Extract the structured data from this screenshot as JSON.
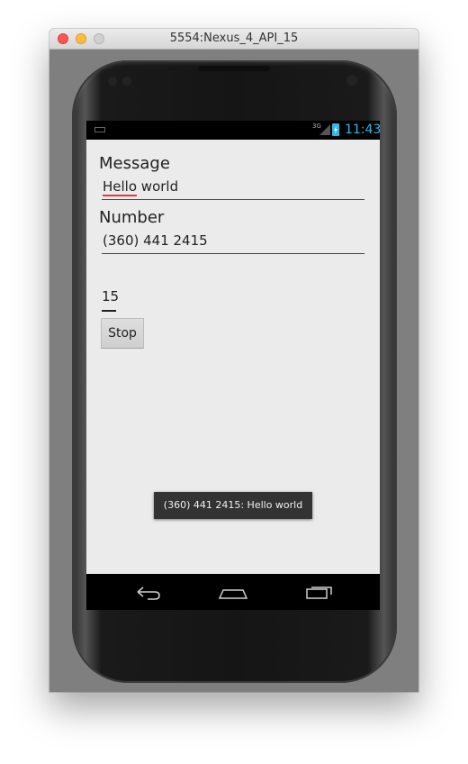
{
  "window": {
    "title": "5554:Nexus_4_API_15"
  },
  "status_bar": {
    "network": "3G",
    "time": "11:43"
  },
  "app": {
    "message_label": "Message",
    "message_value_word1": "Hello",
    "message_value_rest": " world",
    "number_label": "Number",
    "number_value": "(360) 441 2415",
    "counter_value": "15",
    "stop_button": "Stop"
  },
  "toast": {
    "text": "(360) 441 2415: Hello world"
  },
  "icons": {
    "keyboard": "keyboard-icon",
    "signal": "signal-icon",
    "battery": "battery-charging-icon",
    "back": "back-icon",
    "home": "home-icon",
    "recents": "recent-apps-icon"
  },
  "colors": {
    "status_accent": "#33b5e5",
    "spellcheck_underline": "#e53935",
    "app_background": "#ebebeb",
    "toast_background": "#333333"
  }
}
